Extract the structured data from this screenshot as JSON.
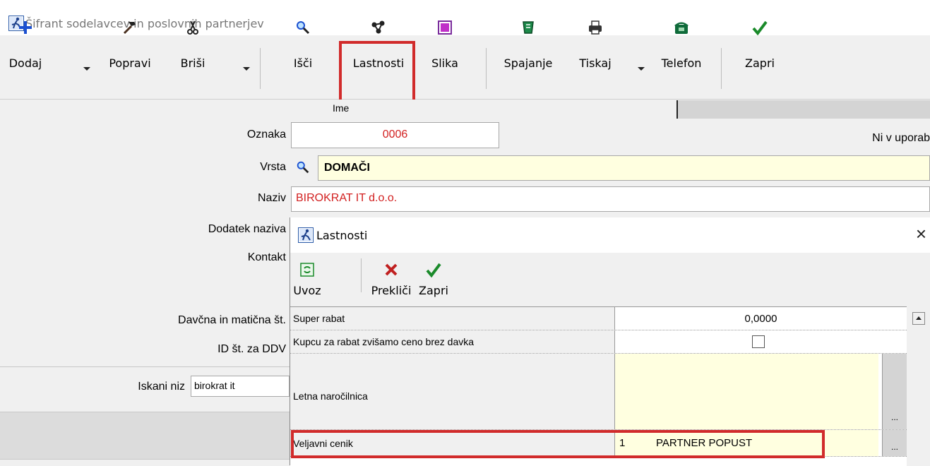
{
  "window": {
    "title": "Šifrant sodelavcev in poslovnih partnerjev",
    "icon": "runner-app-icon"
  },
  "toolbar": {
    "items": [
      {
        "label": "Dodaj",
        "icon": "plus-icon"
      },
      {
        "label": "Popravi",
        "icon": "hammer-icon"
      },
      {
        "label": "Briši",
        "icon": "scissors-icon"
      },
      {
        "label": "Išči",
        "icon": "magnifier-icon"
      },
      {
        "label": "Lastnosti",
        "icon": "properties-icon"
      },
      {
        "label": "Slika",
        "icon": "picture-icon"
      },
      {
        "label": "Spajanje",
        "icon": "merge-icon"
      },
      {
        "label": "Tiskaj",
        "icon": "printer-icon"
      },
      {
        "label": "Telefon",
        "icon": "phone-icon"
      },
      {
        "label": "Zapri",
        "icon": "checkmark-icon"
      }
    ],
    "highlight_color": "#d12b2b"
  },
  "tabs": {
    "ime": "Ime"
  },
  "form": {
    "oznaka": {
      "label": "Oznaka",
      "value": "0006"
    },
    "status": "Ni v uporab",
    "vrsta": {
      "label": "Vrsta",
      "value": "DOMAČI"
    },
    "naziv": {
      "label": "Naziv",
      "value": "BIROKRAT IT d.o.o."
    },
    "dodatek": {
      "label": "Dodatek naziva"
    },
    "kontakt": {
      "label": "Kontakt"
    },
    "davcna": {
      "label": "Davčna in matična št."
    },
    "id_ddv": {
      "label": "ID št. za DDV"
    },
    "search": {
      "label": "Iskani niz",
      "value": "birokrat it"
    }
  },
  "dialog": {
    "title": "Lastnosti",
    "close": "×",
    "toolbar": [
      {
        "label": "Uvoz",
        "icon": "import-icon"
      },
      {
        "label": "Prekliči",
        "icon": "red-x-icon"
      },
      {
        "label": "Zapri",
        "icon": "checkmark-icon"
      }
    ],
    "rows": [
      {
        "name": "Super rabat",
        "value": "0,0000"
      },
      {
        "name": "Kupcu za rabat zvišamo ceno brez davka",
        "value": ""
      },
      {
        "name": "Letna naročilnica",
        "value": "",
        "button": "..."
      },
      {
        "name": "Veljavni cenik",
        "value_num": "1",
        "value": "PARTNER POPUST",
        "button": "..."
      }
    ]
  },
  "colors": {
    "highlight": "#d12b2b",
    "field_yellow": "#ffffe0",
    "red_text": "#d22020"
  }
}
